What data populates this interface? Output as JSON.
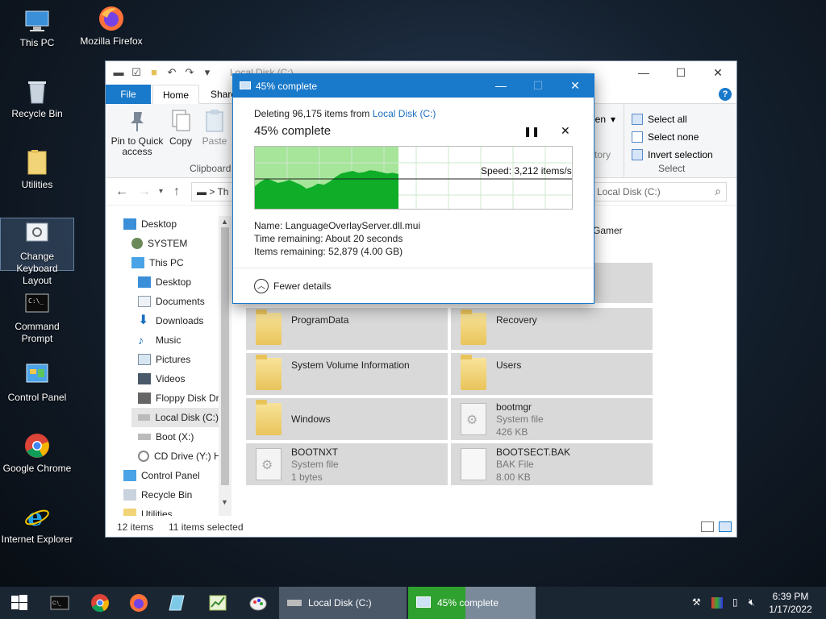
{
  "desktop": {
    "icons": [
      {
        "label": "This PC",
        "icon": "this-pc-icon"
      },
      {
        "label": "Mozilla Firefox",
        "icon": "firefox-icon"
      },
      {
        "label": "Recycle Bin",
        "icon": "recycle-bin-icon"
      },
      {
        "label": "Utilities",
        "icon": "folder-icon"
      },
      {
        "label": "Change Keyboard Layout",
        "icon": "keyboard-settings-icon"
      },
      {
        "label": "Command Prompt",
        "icon": "command-prompt-icon"
      },
      {
        "label": "Control Panel",
        "icon": "control-panel-icon"
      },
      {
        "label": "Google Chrome",
        "icon": "chrome-icon"
      },
      {
        "label": "Internet Explorer",
        "icon": "internet-explorer-icon"
      }
    ]
  },
  "explorer": {
    "title": "Local Disk (C:)",
    "tabs": {
      "file": "File",
      "home": "Home",
      "share": "Share"
    },
    "ribbon": {
      "pin": "Pin to Quick access",
      "copy": "Copy",
      "paste": "Paste",
      "clipboard": "Clipboard",
      "open_partial": "pen",
      "edit_partial": "it",
      "history_partial": "story",
      "select_all": "Select all",
      "select_none": "Select none",
      "invert_selection": "Invert selection",
      "select_group": "Select"
    },
    "address": "Th",
    "search_placeholder": "h Local Disk (C:)",
    "nav": [
      {
        "label": "Desktop"
      },
      {
        "label": "SYSTEM"
      },
      {
        "label": "This PC"
      },
      {
        "label": "Desktop"
      },
      {
        "label": "Documents"
      },
      {
        "label": "Downloads"
      },
      {
        "label": "Music"
      },
      {
        "label": "Pictures"
      },
      {
        "label": "Videos"
      },
      {
        "label": "Floppy Disk Dri"
      },
      {
        "label": "Local Disk (C:)"
      },
      {
        "label": "Boot (X:)"
      },
      {
        "label": "CD Drive (Y:) H"
      },
      {
        "label": "Control Panel"
      },
      {
        "label": "Recycle Bin"
      },
      {
        "label": "Utilities"
      }
    ],
    "partial_text": "Gamer",
    "tiles": [
      {
        "name": "ProgramData",
        "sub1": "",
        "sub2": ""
      },
      {
        "name": "Recovery",
        "sub1": "",
        "sub2": ""
      },
      {
        "name": "System Volume Information",
        "sub1": "",
        "sub2": ""
      },
      {
        "name": "Users",
        "sub1": "",
        "sub2": ""
      },
      {
        "name": "Windows",
        "sub1": "",
        "sub2": ""
      },
      {
        "name": "bootmgr",
        "sub1": "System file",
        "sub2": "426 KB"
      },
      {
        "name": "BOOTNXT",
        "sub1": "System file",
        "sub2": "1 bytes"
      },
      {
        "name": "BOOTSECT.BAK",
        "sub1": "BAK File",
        "sub2": "8.00 KB"
      }
    ],
    "status": {
      "items": "12 items",
      "selected": "11 items selected"
    }
  },
  "dialog": {
    "title": "45% complete",
    "deleting_prefix": "Deleting 96,175 items from ",
    "deleting_link": "Local Disk (C:)",
    "percent_text": "45% complete",
    "progress": 0.45,
    "speed": "Speed: 3,212 items/s",
    "name_line": "Name:  LanguageOverlayServer.dll.mui",
    "time_line": "Time remaining:  About 20 seconds",
    "items_line": "Items remaining:  52,879 (4.00 GB)",
    "fewer_details": "Fewer details",
    "colors": {
      "fill": "#0fad28",
      "fill_light": "#a6e59a",
      "accent": "#1979ca"
    }
  },
  "taskbar": {
    "explorer_label": "Local Disk (C:)",
    "progress_label": "45% complete",
    "progress": 0.45,
    "time": "6:39 PM",
    "date": "1/17/2022"
  }
}
